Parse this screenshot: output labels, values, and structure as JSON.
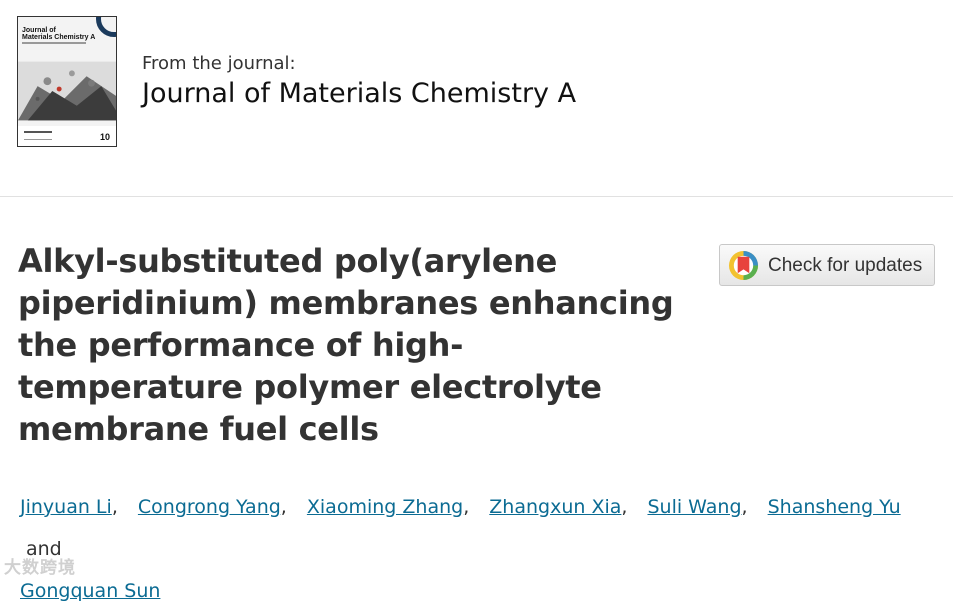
{
  "cover": {
    "title_line1": "Journal of",
    "title_line2": "Materials Chemistry A",
    "badge": "10"
  },
  "journal": {
    "from_label": "From the journal:",
    "name": "Journal of Materials Chemistry A"
  },
  "article": {
    "title": "Alkyl-substituted poly(arylene piperidinium) membranes enhancing the performance of high-temperature polymer electrolyte membrane fuel cells"
  },
  "check_updates": {
    "label": "Check for updates",
    "icon": "crossmark-icon"
  },
  "authors": {
    "list": [
      "Jinyuan Li",
      "Congrong Yang",
      "Xiaoming Zhang",
      "Zhangxun Xia",
      "Suli Wang",
      "Shansheng Yu",
      "Gongquan Sun"
    ],
    "and_label": "and",
    "separator": ","
  },
  "watermark": {
    "text": "大数跨境"
  }
}
